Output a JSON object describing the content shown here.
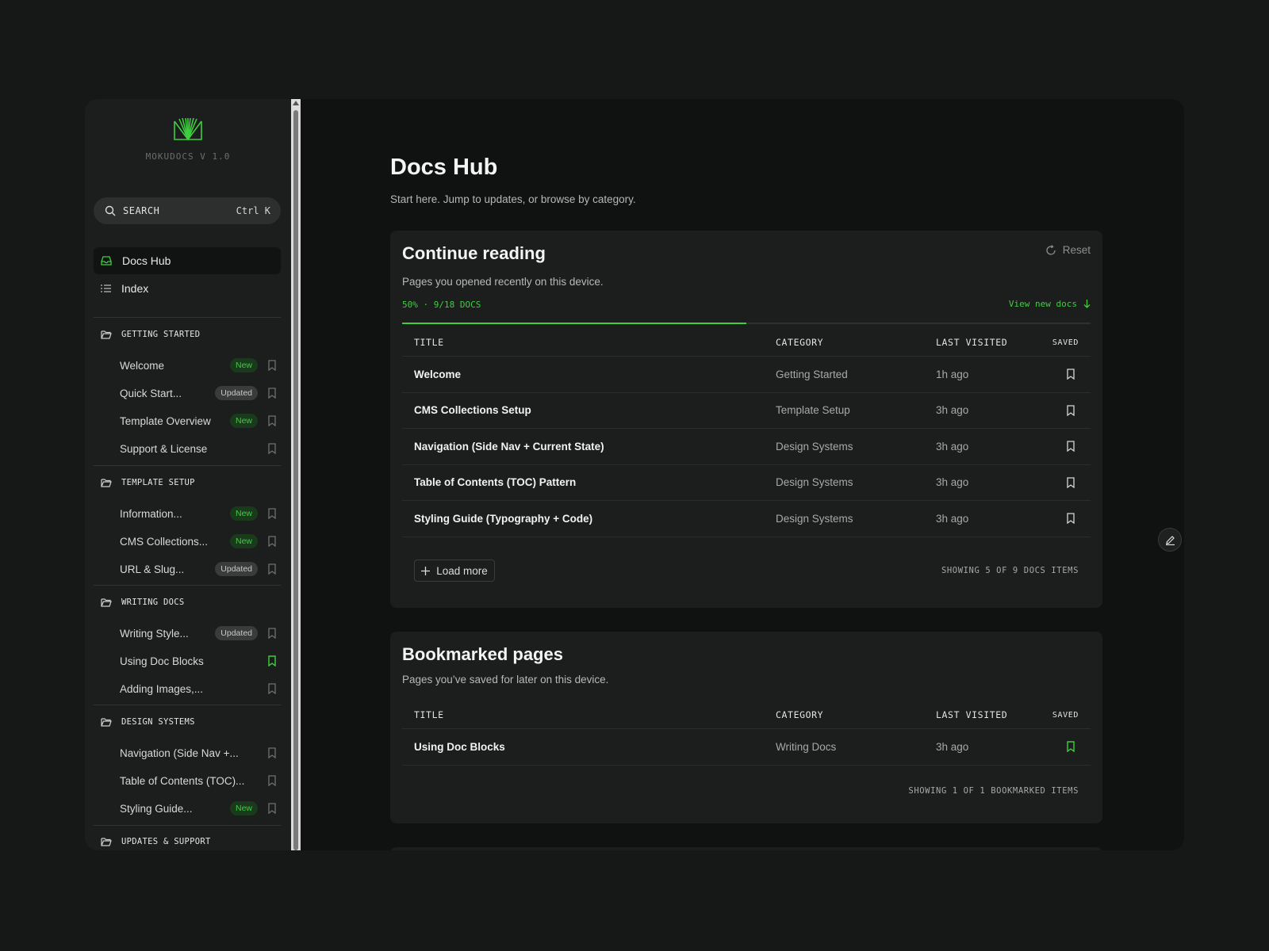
{
  "brand": {
    "version": "MOKUDOCS V 1.0",
    "logo_icon": "book-fan-logo",
    "accent": "#3ecf3e"
  },
  "search": {
    "label": "SEARCH",
    "shortcut": "Ctrl K"
  },
  "nav": {
    "primary": [
      {
        "label": "Docs Hub",
        "icon": "stack-icon",
        "active": true
      },
      {
        "label": "Index",
        "icon": "list-icon",
        "active": false
      }
    ],
    "sections": [
      {
        "title": "GETTING STARTED",
        "items": [
          {
            "label": "Welcome",
            "badge": "New",
            "bookmarked": false
          },
          {
            "label": "Quick Start...",
            "badge": "Updated",
            "bookmarked": false
          },
          {
            "label": "Template Overview",
            "badge": "New",
            "bookmarked": false
          },
          {
            "label": "Support & License",
            "badge": "",
            "bookmarked": false
          }
        ]
      },
      {
        "title": "TEMPLATE SETUP",
        "items": [
          {
            "label": "Information...",
            "badge": "New",
            "bookmarked": false
          },
          {
            "label": "CMS Collections...",
            "badge": "New",
            "bookmarked": false
          },
          {
            "label": "URL & Slug...",
            "badge": "Updated",
            "bookmarked": false
          }
        ]
      },
      {
        "title": "WRITING DOCS",
        "items": [
          {
            "label": "Writing Style...",
            "badge": "Updated",
            "bookmarked": false
          },
          {
            "label": "Using Doc Blocks",
            "badge": "",
            "bookmarked": true
          },
          {
            "label": "Adding Images,...",
            "badge": "",
            "bookmarked": false
          }
        ]
      },
      {
        "title": "DESIGN SYSTEMS",
        "items": [
          {
            "label": "Navigation (Side Nav +...",
            "badge": "",
            "bookmarked": false
          },
          {
            "label": "Table of Contents (TOC)...",
            "badge": "",
            "bookmarked": false
          },
          {
            "label": "Styling Guide...",
            "badge": "New",
            "bookmarked": false
          }
        ]
      },
      {
        "title": "UPDATES & SUPPORT",
        "items": []
      }
    ]
  },
  "page": {
    "title": "Docs Hub",
    "subtitle": "Start here. Jump to updates, or browse by category."
  },
  "continue_reading": {
    "title": "Continue reading",
    "subtitle": "Pages you opened recently on this device.",
    "reset_label": "Reset",
    "progress_label": "50% · 9/18 DOCS",
    "progress_fraction": 0.5,
    "view_new_label": "View new docs",
    "columns": [
      "TITLE",
      "CATEGORY",
      "LAST VISITED",
      "SAVED"
    ],
    "rows": [
      {
        "title": "Welcome",
        "category": "Getting Started",
        "last": "1h ago",
        "saved": false
      },
      {
        "title": "CMS Collections Setup",
        "category": "Template Setup",
        "last": "3h ago",
        "saved": false
      },
      {
        "title": "Navigation (Side Nav + Current State)",
        "category": "Design Systems",
        "last": "3h ago",
        "saved": false
      },
      {
        "title": "Table of Contents (TOC) Pattern",
        "category": "Design Systems",
        "last": "3h ago",
        "saved": false
      },
      {
        "title": "Styling Guide (Typography + Code)",
        "category": "Design Systems",
        "last": "3h ago",
        "saved": false
      }
    ],
    "load_more_label": "Load more",
    "showing_label": "SHOWING 5 OF 9 DOCS ITEMS"
  },
  "bookmarked": {
    "title": "Bookmarked pages",
    "subtitle": "Pages you’ve saved for later on this device.",
    "columns": [
      "TITLE",
      "CATEGORY",
      "LAST VISITED",
      "SAVED"
    ],
    "rows": [
      {
        "title": "Using Doc Blocks",
        "category": "Writing Docs",
        "last": "3h ago",
        "saved": true
      }
    ],
    "showing_label": "SHOWING 1 OF 1 BOOKMARKED ITEMS"
  },
  "fab": {
    "icon": "edit-pencil-icon"
  }
}
